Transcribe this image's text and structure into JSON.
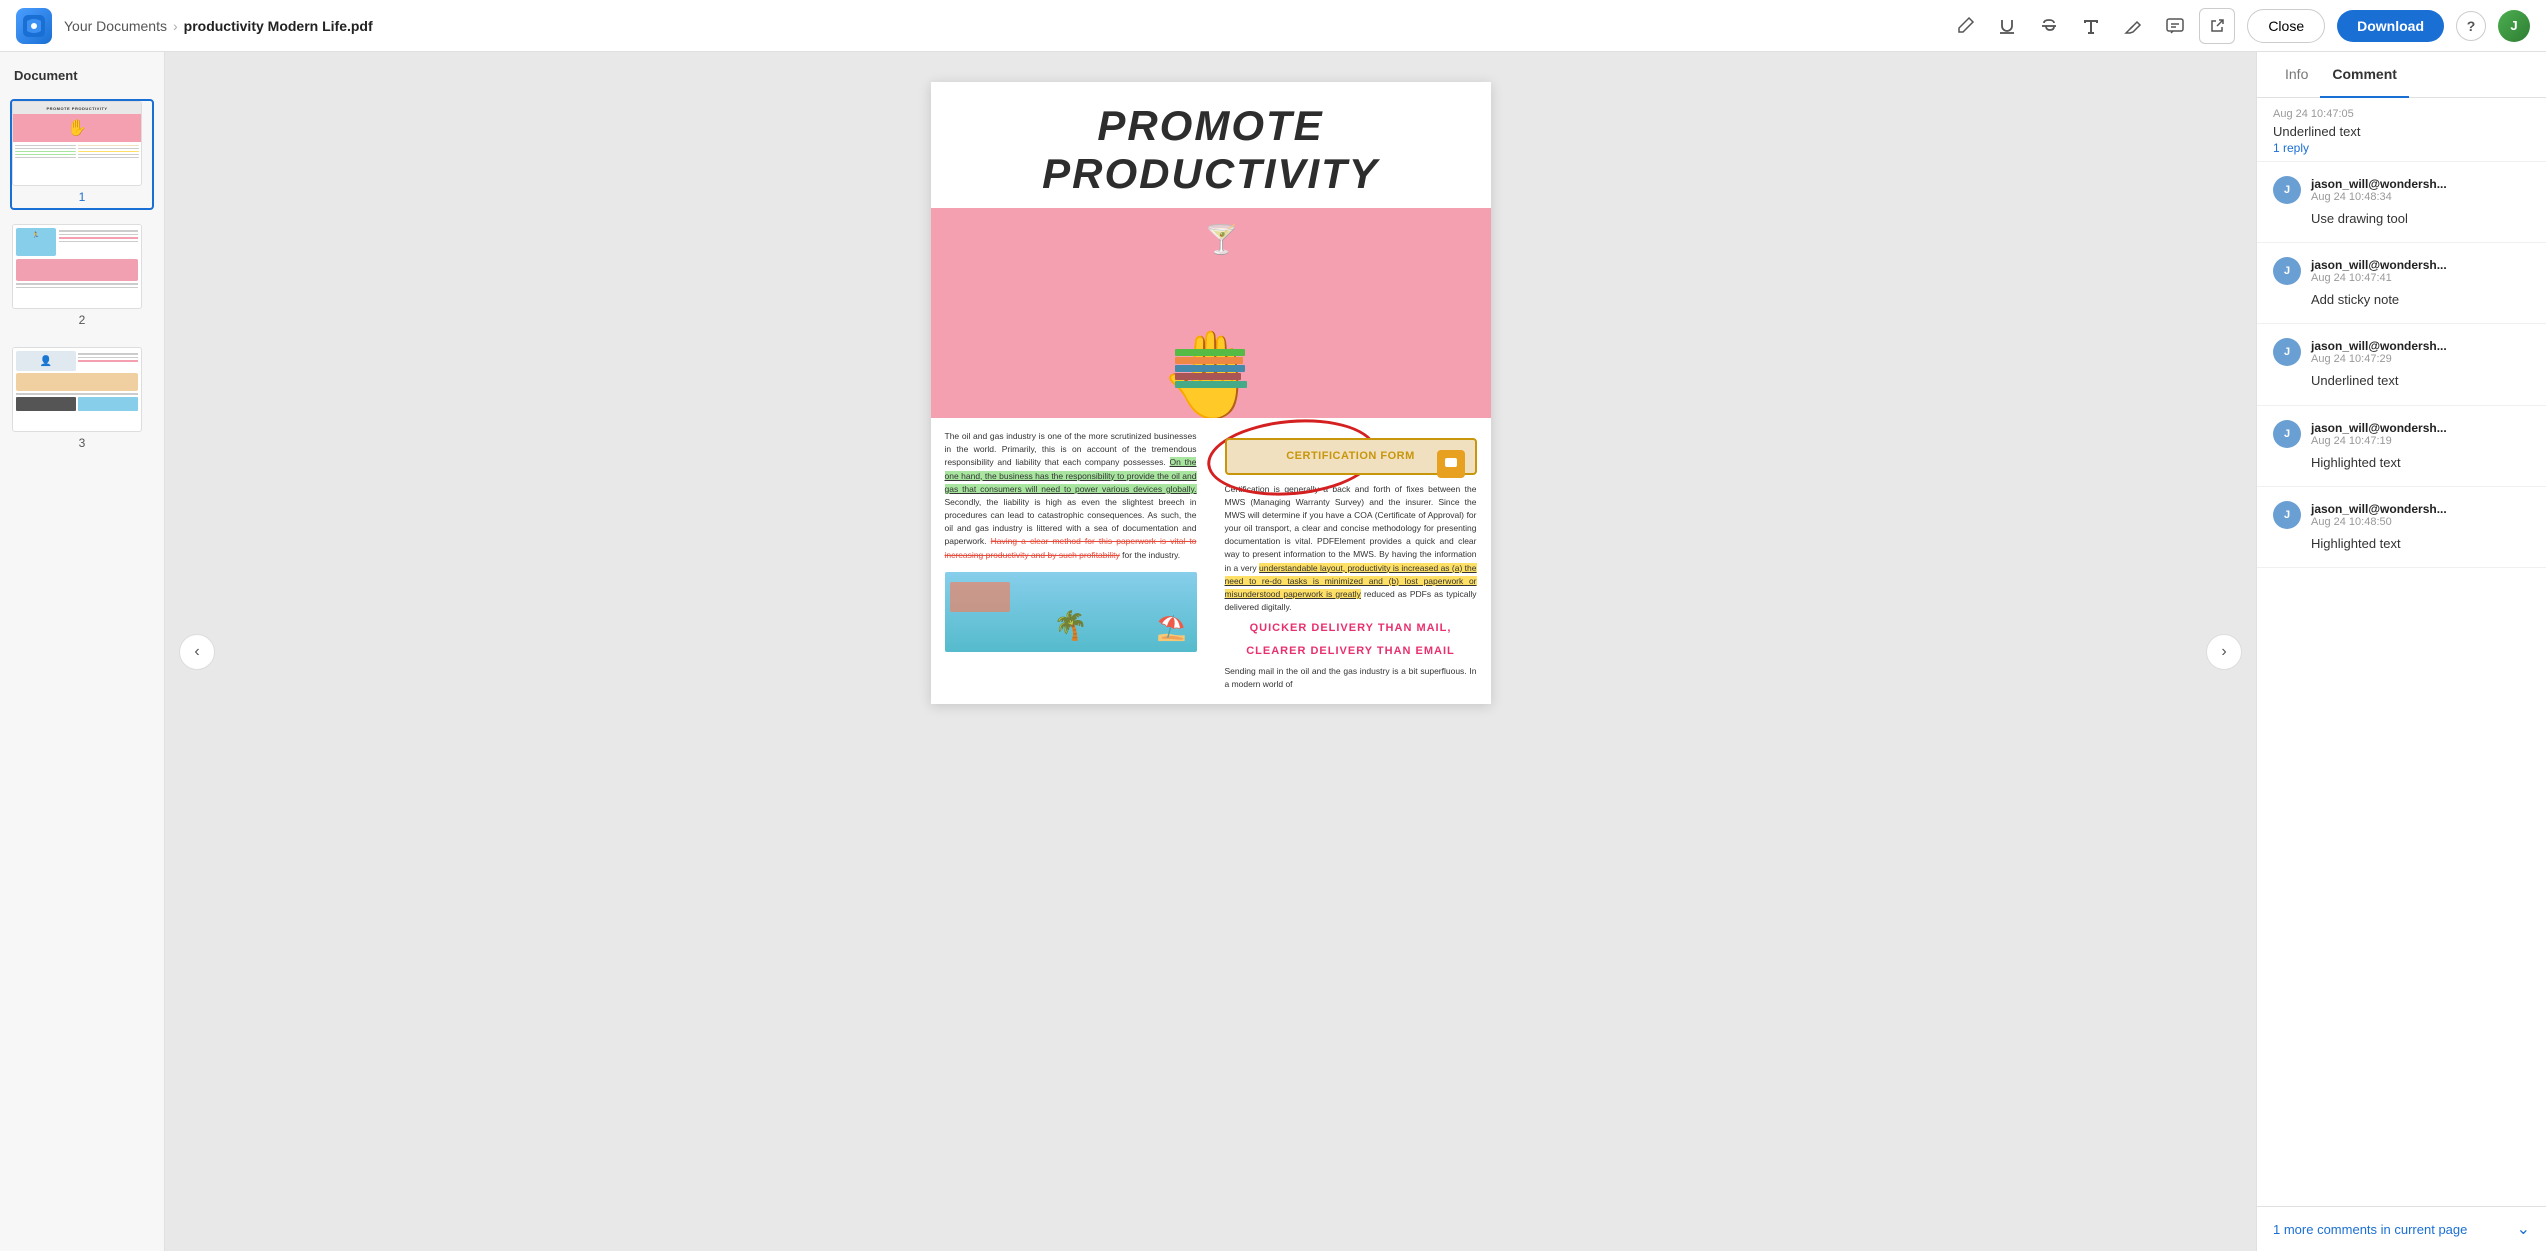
{
  "app": {
    "logo_text": "W",
    "breadcrumb_parent": "Your Documents",
    "breadcrumb_current": "productivity Modern Life.pdf"
  },
  "toolbar": {
    "tools": [
      "pencil",
      "underline",
      "strikethrough",
      "text",
      "eraser",
      "comment"
    ],
    "external_link_label": "↗",
    "close_label": "Close",
    "download_label": "Download",
    "help_label": "?",
    "avatar_label": "J"
  },
  "sidebar_left": {
    "title": "Document",
    "pages": [
      {
        "num": "1",
        "active": true
      },
      {
        "num": "2",
        "active": false
      },
      {
        "num": "3",
        "active": false
      }
    ]
  },
  "pdf": {
    "title": "PROMOTE PRODUCTIVITY",
    "left_col_text_before": "The oil and gas industry is one of the more scrutinized businesses in the world. Primarily, this is on account of the tremendous responsibility and liability that each company possesses.",
    "left_col_highlight": "On the one hand, the business has the responsibility to provide the oil and gas that consumers will need to power various devices globally.",
    "left_col_text_after": "Secondly, the liability is high as even the slightest breech in procedures can lead to catastrophic consequences. As such, the oil and gas industry is littered with a sea of documentation and paperwork.",
    "left_col_strikethrough": "Having a clear method for this paperwork is vital to increasing productivity and by such profitability",
    "left_col_end": "for the industry.",
    "cert_title": "CERTIFICATION FORM",
    "cert_text": "Certification is generally a back and forth of fixes between the MWS (Managing Warranty Survey) and the insurer. Since the MWS will determine if you have a COA (Certificate of Approval) for your oil transport, a clear and concise methodology for presenting documentation is vital. PDFElement provides a quick and clear way to present information to the MWS. By having the information in a very",
    "right_highlight": "understandable layout, productivity is increased as (a) the need to re-do tasks is minimized and (b) lost paperwork or misunderstood paperwork is greatly",
    "right_end": "reduced as PDFs as typically delivered digitally.",
    "pink_line1": "QUICKER   DELIVERY   THAN   MAIL,",
    "pink_line2": "CLEARER DELIVERY THAN EMAIL",
    "bottom_text": "Sending mail in the oil and the gas industry is a bit superfluous. In a modern world of"
  },
  "sidebar_right": {
    "tabs": [
      {
        "label": "Info",
        "active": false
      },
      {
        "label": "Comment",
        "active": true
      }
    ],
    "top_comment": {
      "time": "Aug 24 10:47:05",
      "text": "Underlined text",
      "reply_label": "1 reply"
    },
    "comments": [
      {
        "id": 1,
        "author": "jason_will@wondersh...",
        "time": "Aug 24 10:48:34",
        "text": "Use drawing tool",
        "avatar_label": "J"
      },
      {
        "id": 2,
        "author": "jason_will@wondersh...",
        "time": "Aug 24 10:47:41",
        "text": "Add sticky note",
        "avatar_label": "J"
      },
      {
        "id": 3,
        "author": "jason_will@wondersh...",
        "time": "Aug 24 10:47:29",
        "text": "Underlined text",
        "avatar_label": "J"
      },
      {
        "id": 4,
        "author": "jason_will@wondersh...",
        "time": "Aug 24 10:47:19",
        "text": "Highlighted text",
        "avatar_label": "J"
      },
      {
        "id": 5,
        "author": "jason_will@wondersh...",
        "time": "Aug 24 10:48:50",
        "text": "Highlighted text",
        "avatar_label": "J"
      }
    ],
    "more_comments_label": "1 more comments in current page",
    "expand_icon": "⌄"
  }
}
